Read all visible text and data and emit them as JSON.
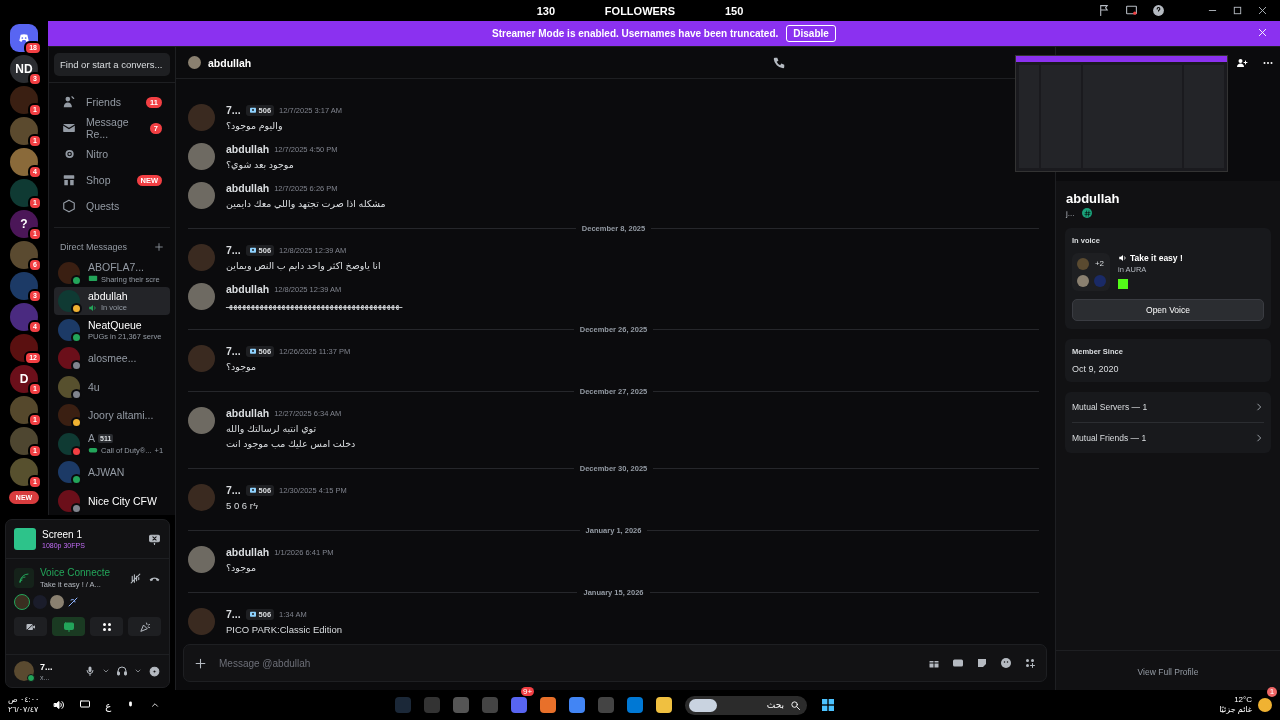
{
  "top_bar": {
    "left_count": "130",
    "title": "FOLLOWERS",
    "right_count": "150"
  },
  "servers": [
    {
      "kind": "home",
      "badge": "18"
    },
    {
      "kind": "server",
      "label": "ND",
      "badge": "3"
    },
    {
      "kind": "server",
      "badge": "1"
    },
    {
      "kind": "server",
      "badge": "1"
    },
    {
      "kind": "server",
      "badge": "4"
    },
    {
      "kind": "server",
      "badge": "1"
    },
    {
      "kind": "server",
      "label": "?",
      "badge": "1"
    },
    {
      "kind": "server",
      "badge": "6"
    },
    {
      "kind": "server",
      "badge": "3"
    },
    {
      "kind": "server",
      "badge": "4"
    },
    {
      "kind": "server",
      "badge": "12"
    },
    {
      "kind": "server",
      "label": "D",
      "badge": "1"
    },
    {
      "kind": "server",
      "badge": "1"
    },
    {
      "kind": "server",
      "badge": "1"
    },
    {
      "kind": "server",
      "badge": "1"
    }
  ],
  "new_pill": "NEW",
  "banner": {
    "text": "Streamer Mode is enabled. Usernames have been truncated.",
    "button": "Disable"
  },
  "sidebar": {
    "search": "Find or start a convers...",
    "nav": [
      {
        "label": "Friends",
        "badge": "11"
      },
      {
        "label": "Message Re...",
        "badge": "7"
      },
      {
        "label": "Nitro"
      },
      {
        "label": "Shop",
        "badge": "NEW"
      },
      {
        "label": "Quests"
      }
    ],
    "dm_header": "Direct Messages",
    "dms": [
      {
        "kind": "stream",
        "name": "ABOFLA7...",
        "color": "#23a55a",
        "activity": "Sharing their scre",
        "selected": false,
        "unread": false
      },
      {
        "kind": "voice",
        "name": "abdullah",
        "color": "#f0b232",
        "activity": "In voice",
        "selected": true,
        "unread": false
      },
      {
        "kind": "text",
        "name": "NeatQueue",
        "color": "#23a55a",
        "activity": "PUGs in 21,367 serve",
        "selected": false,
        "unread": true
      },
      {
        "kind": "plain",
        "name": "alosmee...",
        "color": "#80848e",
        "selected": false,
        "unread": false
      },
      {
        "kind": "plain",
        "name": "4u",
        "color": "#80848e",
        "selected": false,
        "unread": false
      },
      {
        "kind": "plain",
        "name": "Joory altami...",
        "color": "#f0b232",
        "selected": false,
        "unread": false
      },
      {
        "kind": "game",
        "name": "A",
        "tag": "511",
        "color": "#f23f43",
        "activity": "Call of Duty®...",
        "extra": "+1",
        "selected": false,
        "unread": false
      },
      {
        "kind": "plain",
        "name": "AJWAN",
        "color": "#23a55a",
        "selected": false,
        "unread": false
      },
      {
        "kind": "plain",
        "name": "Nice City CFW",
        "color": "#80848e",
        "selected": false,
        "unread": true
      }
    ]
  },
  "voice_panel": {
    "stream_title": "Screen 1",
    "stream_quality": "1080p 30FPS",
    "voice_status": "Voice Connecte",
    "voice_channel": "Take it easy ! / A...",
    "screen_share_on": true
  },
  "user": {
    "name": "7...",
    "status_text": "x..."
  },
  "chat": {
    "recipient": "abdullah",
    "items": [
      {
        "kind": "message",
        "author": "7...",
        "tag": "506",
        "time": "12/7/2025 3:17 AM",
        "lines": [
          "واليوم موجود؟"
        ]
      },
      {
        "kind": "message",
        "author": "abdullah",
        "time": "12/7/2025 4:50 PM",
        "lines": [
          "موجود بعد شوي؟"
        ]
      },
      {
        "kind": "message",
        "author": "abdullah",
        "time": "12/7/2025 6:26 PM",
        "lines": [
          "مشكله اذا صرت تجتهد واللي معك دايمين"
        ]
      },
      {
        "kind": "divider",
        "label": "December 8, 2025"
      },
      {
        "kind": "message",
        "author": "7...",
        "tag": "506",
        "time": "12/8/2025 12:39 AM",
        "lines": [
          "انا ياوصخ اكثر واحد دايم ب النص ويماين"
        ]
      },
      {
        "kind": "message",
        "author": "abdullah",
        "time": "12/8/2025 12:39 AM",
        "lines": [
          "ـهههههههههههههههههههههههههههههههههههههههـ"
        ]
      },
      {
        "kind": "divider",
        "label": "December 26, 2025"
      },
      {
        "kind": "message",
        "author": "7...",
        "tag": "506",
        "time": "12/26/2025 11:37 PM",
        "lines": [
          "موجود؟"
        ]
      },
      {
        "kind": "divider",
        "label": "December 27, 2025"
      },
      {
        "kind": "message",
        "author": "abdullah",
        "time": "12/27/2025 6:34 AM",
        "lines": [
          "توي انتبه لرسالتك والله",
          "دخلت امس عليك مب موجود انت"
        ]
      },
      {
        "kind": "divider",
        "label": "December 30, 2025"
      },
      {
        "kind": "message",
        "author": "7...",
        "tag": "506",
        "time": "12/30/2025 4:15 PM",
        "lines": [
          "5 0 6 rϟ"
        ]
      },
      {
        "kind": "divider",
        "label": "January 1, 2026"
      },
      {
        "kind": "message",
        "author": "abdullah",
        "time": "1/1/2026 6:41 PM",
        "lines": [
          "موجود؟"
        ]
      },
      {
        "kind": "divider",
        "label": "January 15, 2026"
      },
      {
        "kind": "message",
        "author": "7...",
        "tag": "506",
        "time": "1:34 AM",
        "lines": [
          "PICO PARK:Classic Edition"
        ]
      }
    ],
    "composer_placeholder": "Message @abdullah"
  },
  "profile": {
    "name": "abdullah",
    "handle": "j...",
    "voice_heading": "In voice",
    "voice_count": "+2",
    "voice_channel": "Take it easy !",
    "voice_server": "in AURA",
    "open_voice": "Open Voice",
    "member_since_heading": "Member Since",
    "member_since": "Oct 9, 2020",
    "mutuals": [
      "Mutual Servers — 1",
      "Mutual Friends — 1"
    ],
    "view_full": "View Full Profile"
  },
  "taskbar": {
    "time": "٠٤:٠٠ ص",
    "date": "٢٦/٠٧/٤٧",
    "language": "ع",
    "search_placeholder": "بحث",
    "app_badge": "9+",
    "weather_temp": "12°C",
    "weather_text": "غائم جزئيًا",
    "weather_badge": "1"
  }
}
